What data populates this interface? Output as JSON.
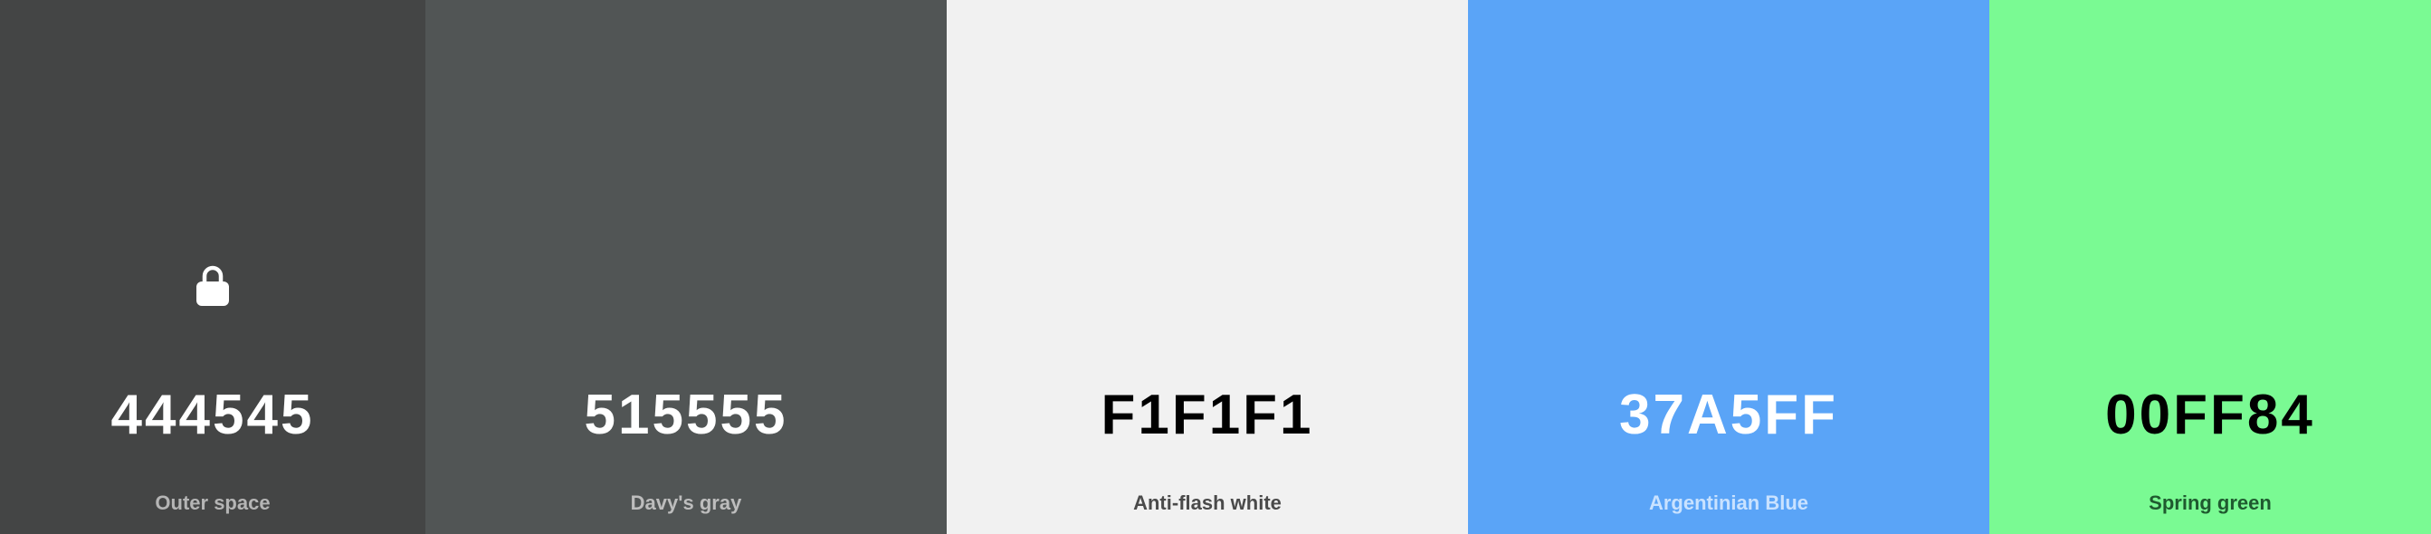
{
  "swatches": [
    {
      "hex": "444545",
      "name": "Outer space",
      "color": "#444545",
      "hex_color": "#FFFFFF",
      "name_color": "#B5B5B5",
      "locked": true
    },
    {
      "hex": "515555",
      "name": "Davy's gray",
      "color": "#515555",
      "hex_color": "#FFFFFF",
      "name_color": "#BDBDBD",
      "locked": false
    },
    {
      "hex": "F1F1F1",
      "name": "Anti-flash white",
      "color": "#F1F1F1",
      "hex_color": "#000000",
      "name_color": "#4A4A4A",
      "locked": false
    },
    {
      "hex": "37A5FF",
      "name": "Argentinian Blue",
      "color": "#5AA4F7",
      "hex_color": "#FFFFFF",
      "name_color": "#C9E2FF",
      "locked": false
    },
    {
      "hex": "00FF84",
      "name": "Spring green",
      "color": "#7AFA93",
      "hex_color": "#000000",
      "name_color": "#1F5A2F",
      "locked": false
    }
  ],
  "icons": {
    "lock": "lock-icon"
  }
}
